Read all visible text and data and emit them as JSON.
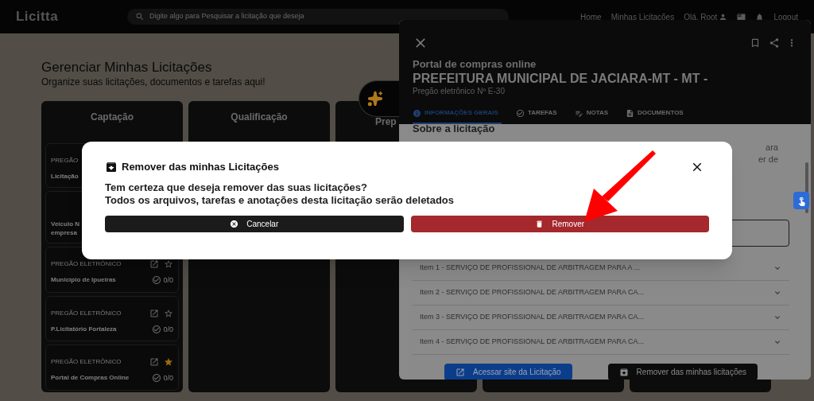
{
  "header": {
    "logo": "Licitta",
    "search": {
      "placeholder": "Digite algo para Pesquisar a licitação que deseja"
    },
    "nav": [
      "Home",
      "Minhas Licitações",
      "Olá, Root"
    ],
    "logout": "Logout"
  },
  "page": {
    "title": "Gerenciar Minhas Licitações",
    "subtitle": "Organize suas licitações, documentos e tarefas aqui!"
  },
  "columns": [
    {
      "title": "Captação",
      "cards": [
        {
          "type": "PREGÃO",
          "name_lines": [
            "Licitação"
          ]
        },
        {
          "name_lines": [
            "Veículo N",
            "empresa"
          ]
        },
        {
          "type": "PREGÃO ELETRÔNICO",
          "name_lines": [
            "Município de Ipueiras"
          ],
          "tasks": "0/0",
          "starred": false
        },
        {
          "type": "PREGÃO ELETRÔNICO",
          "name_lines": [
            "P.Licitatório Fortaleza"
          ],
          "tasks": "0/0",
          "starred": false
        },
        {
          "type": "PREGÃO ELETRÔNICO",
          "name_lines": [
            "Portal de Compras Online"
          ],
          "tasks": "0/0",
          "starred": true
        }
      ]
    },
    {
      "title": "Qualificação"
    },
    {
      "title": "Prep"
    }
  ],
  "panel": {
    "subtitle": "Portal de compras online",
    "title": "PREFEITURA MUNICIPAL DE JACIARA-MT - MT -",
    "info": "Pregão eletrônico Nº E-30",
    "tabs": [
      {
        "label": "INFORMAÇÕES GERAIS",
        "selected": true
      },
      {
        "label": "TAREFAS",
        "selected": false
      },
      {
        "label": "NOTAS",
        "selected": false
      },
      {
        "label": "DOCUMENTOS",
        "selected": false
      }
    ],
    "section_title": "Sobre a licitação",
    "fragments": [
      "ara",
      "er de"
    ],
    "items": [
      "Item 1 - SERVIÇO DE PROFISSIONAL DE ARBITRAGEM PARA A ...",
      "Item 2 - SERVIÇO DE PROFISSIONAL DE ARBITRAGEM PARA CA...",
      "Item 3 - SERVIÇO DE PROFISSIONAL DE ARBITRAGEM PARA CA...",
      "Item 4 - SERVIÇO DE PROFISSIONAL DE ARBITRAGEM PARA CA..."
    ],
    "open_site": "Acessar site da Licitação",
    "remove": "Remover das minhas licitações"
  },
  "modal": {
    "title": "Remover das minhas Licitações",
    "message_lines": [
      "Tem certeza que deseja remover das suas licitações?",
      "Todos os arquivos, tarefas e anotações desta licitação serão deletados"
    ],
    "buttons": [
      {
        "kind": "cancel",
        "label": "Cancelar"
      },
      {
        "kind": "confirm",
        "label": "Remover"
      }
    ]
  }
}
